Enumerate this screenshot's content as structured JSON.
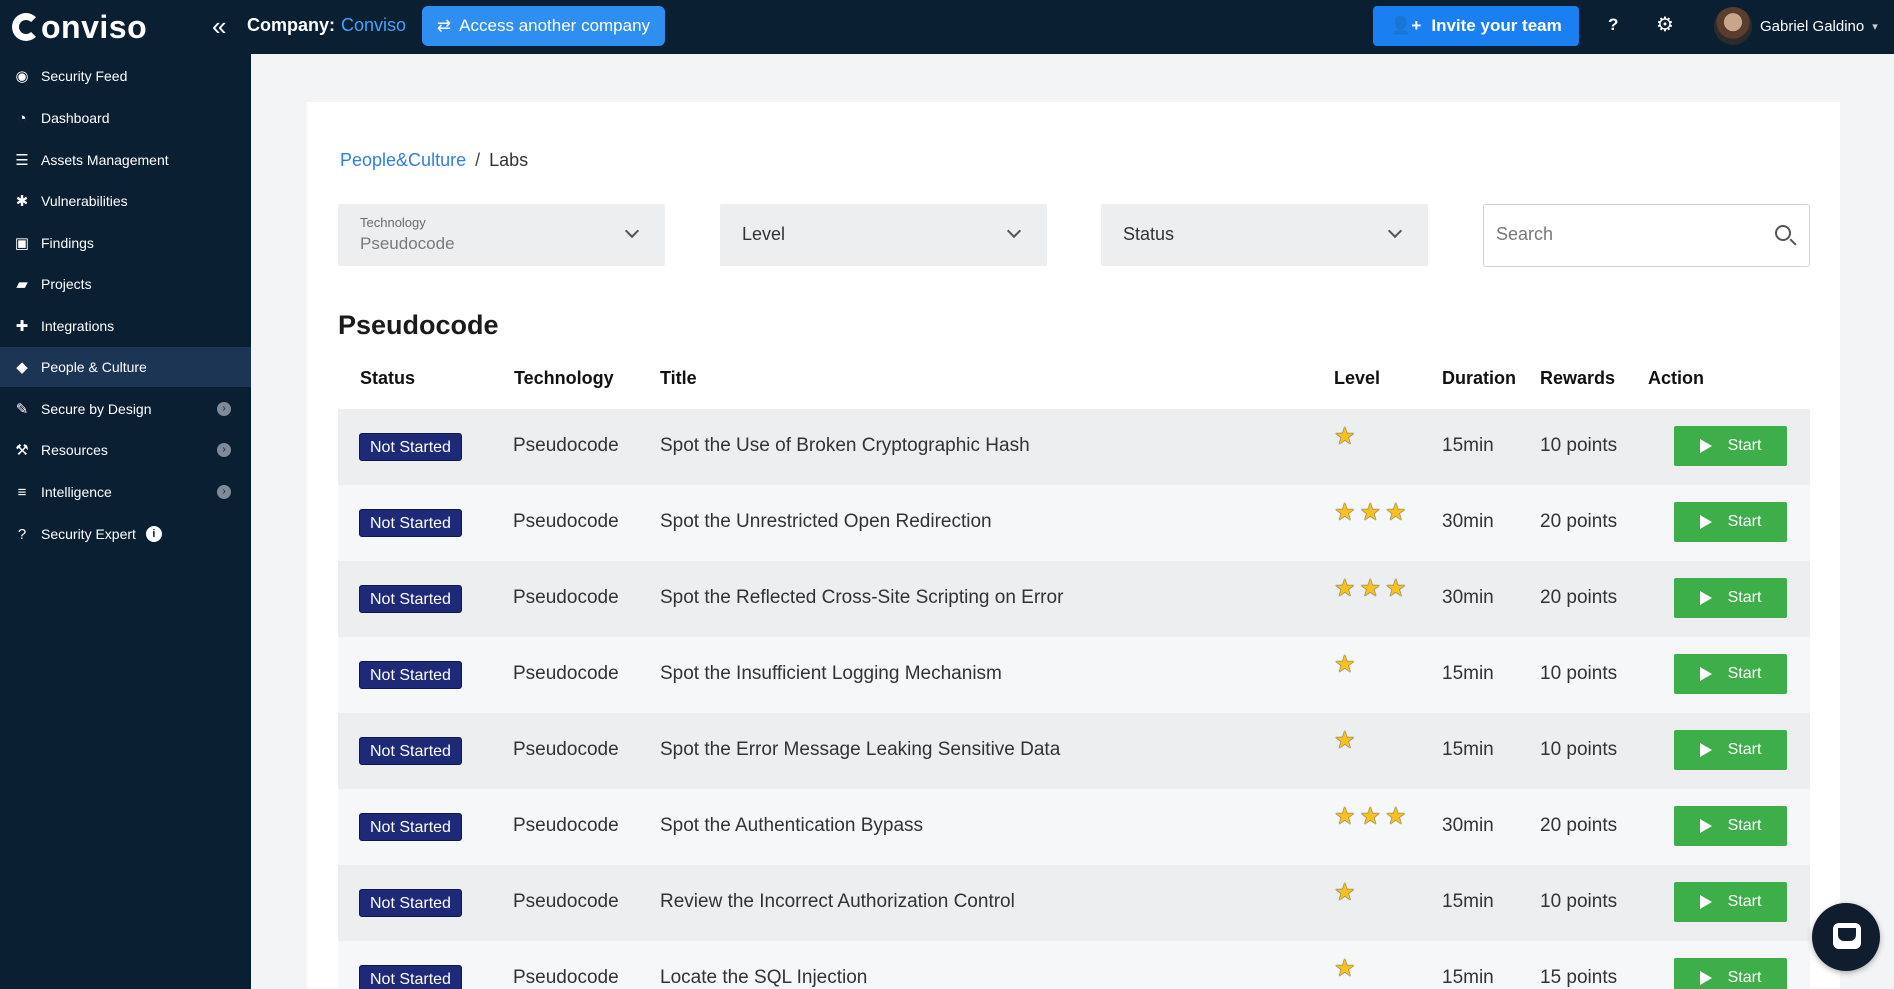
{
  "header": {
    "logo": "onviso",
    "company_label": "Company:",
    "company_name": "Conviso",
    "access_label": "Access another company",
    "invite_label": "Invite your team",
    "help_label": "?",
    "user_name": "Gabriel Galdino"
  },
  "sidebar": {
    "items": [
      {
        "label": "Security Feed",
        "icon": "rss-icon"
      },
      {
        "label": "Dashboard",
        "icon": "gauge-icon"
      },
      {
        "label": "Assets Management",
        "icon": "server-icon"
      },
      {
        "label": "Vulnerabilities",
        "icon": "bug-icon"
      },
      {
        "label": "Findings",
        "icon": "lock-icon"
      },
      {
        "label": "Projects",
        "icon": "folder-icon"
      },
      {
        "label": "Integrations",
        "icon": "puzzle-icon"
      },
      {
        "label": "People & Culture",
        "icon": "graduation-cap-icon"
      },
      {
        "label": "Secure by Design",
        "icon": "edit-icon"
      },
      {
        "label": "Resources",
        "icon": "wrench-icon"
      },
      {
        "label": "Intelligence",
        "icon": "database-icon"
      },
      {
        "label": "Security Expert",
        "icon": "question-circle-icon"
      }
    ],
    "active_index": 7
  },
  "breadcrumb": {
    "parent": "People&Culture",
    "current": "Labs"
  },
  "filters": {
    "technology_label": "Technology",
    "technology_value": "Pseudocode",
    "level_label": "Level",
    "status_label": "Status",
    "search_placeholder": "Search"
  },
  "section_title": "Pseudocode",
  "table": {
    "headers": {
      "status": "Status",
      "technology": "Technology",
      "title": "Title",
      "level": "Level",
      "duration": "Duration",
      "rewards": "Rewards",
      "action": "Action"
    },
    "rows": [
      {
        "status": "Not Started",
        "technology": "Pseudocode",
        "title": "Spot the Use of Broken Cryptographic Hash",
        "level": 1,
        "duration": "15min",
        "rewards": "10 points",
        "action": "Start"
      },
      {
        "status": "Not Started",
        "technology": "Pseudocode",
        "title": "Spot the Unrestricted Open Redirection",
        "level": 3,
        "duration": "30min",
        "rewards": "20 points",
        "action": "Start"
      },
      {
        "status": "Not Started",
        "technology": "Pseudocode",
        "title": "Spot the Reflected Cross-Site Scripting on Error",
        "level": 3,
        "duration": "30min",
        "rewards": "20 points",
        "action": "Start"
      },
      {
        "status": "Not Started",
        "technology": "Pseudocode",
        "title": "Spot the Insufficient Logging Mechanism",
        "level": 1,
        "duration": "15min",
        "rewards": "10 points",
        "action": "Start"
      },
      {
        "status": "Not Started",
        "technology": "Pseudocode",
        "title": "Spot the Error Message Leaking Sensitive Data",
        "level": 1,
        "duration": "15min",
        "rewards": "10 points",
        "action": "Start"
      },
      {
        "status": "Not Started",
        "technology": "Pseudocode",
        "title": "Spot the Authentication Bypass",
        "level": 3,
        "duration": "30min",
        "rewards": "20 points",
        "action": "Start"
      },
      {
        "status": "Not Started",
        "technology": "Pseudocode",
        "title": "Review the Incorrect Authorization Control",
        "level": 1,
        "duration": "15min",
        "rewards": "10 points",
        "action": "Start"
      },
      {
        "status": "Not Started",
        "technology": "Pseudocode",
        "title": "Locate the SQL Injection",
        "level": 1,
        "duration": "15min",
        "rewards": "15 points",
        "action": "Start"
      }
    ]
  },
  "colors": {
    "sidebar_bg": "#0b1f33",
    "accent_blue": "#2f8ff0",
    "start_green": "#3eae4a",
    "badge_navy": "#1e2a78",
    "star_gold": "#f6c21b"
  }
}
